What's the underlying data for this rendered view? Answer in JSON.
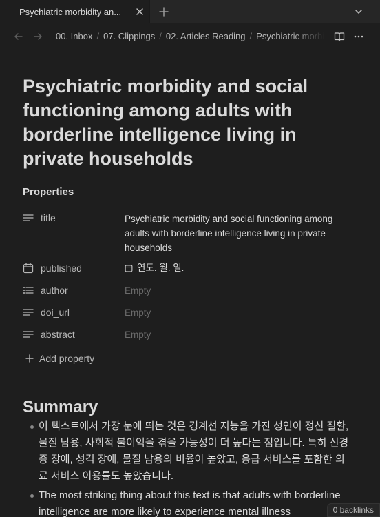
{
  "tab": {
    "title": "Psychiatric morbidity an..."
  },
  "breadcrumb": [
    "00. Inbox",
    "07. Clippings",
    "02. Articles Reading",
    "Psychiatric morbidity and social functioning"
  ],
  "page": {
    "title": "Psychiatric morbidity and social functioning among adults with borderline intelligence living in private households"
  },
  "properties": {
    "heading": "Properties",
    "items": [
      {
        "key": "title",
        "value": "Psychiatric morbidity and social functioning among adults with borderline intelligence living in private households",
        "icon": "text-lines-icon"
      },
      {
        "key": "published",
        "value": "연도. 월. 일.",
        "icon": "calendar-icon"
      },
      {
        "key": "author",
        "value": "Empty",
        "icon": "list-icon"
      },
      {
        "key": "doi_url",
        "value": "Empty",
        "icon": "text-lines-icon"
      },
      {
        "key": "abstract",
        "value": "Empty",
        "icon": "text-lines-icon"
      }
    ],
    "add_label": "Add property"
  },
  "summary": {
    "heading": "Summary",
    "items": [
      "이 텍스트에서 가장 눈에 띄는 것은 경계선 지능을 가진 성인이 정신 질환, 물질 남용, 사회적 불이익을 겪을 가능성이 더 높다는 점입니다. 특히 신경증 장애, 성격 장애, 물질 남용의 비율이 높았고, 응급 서비스를 포함한 의료 서비스 이용률도 높았습니다.",
      "The most striking thing about this text is that adults with borderline intelligence are more likely to experience mental illness"
    ]
  },
  "status": {
    "backlinks": "0 backlinks"
  },
  "colors": {
    "background": "#1e1e1e",
    "tabbar": "#262626",
    "text": "#dadada",
    "muted": "#6b6b6b"
  }
}
